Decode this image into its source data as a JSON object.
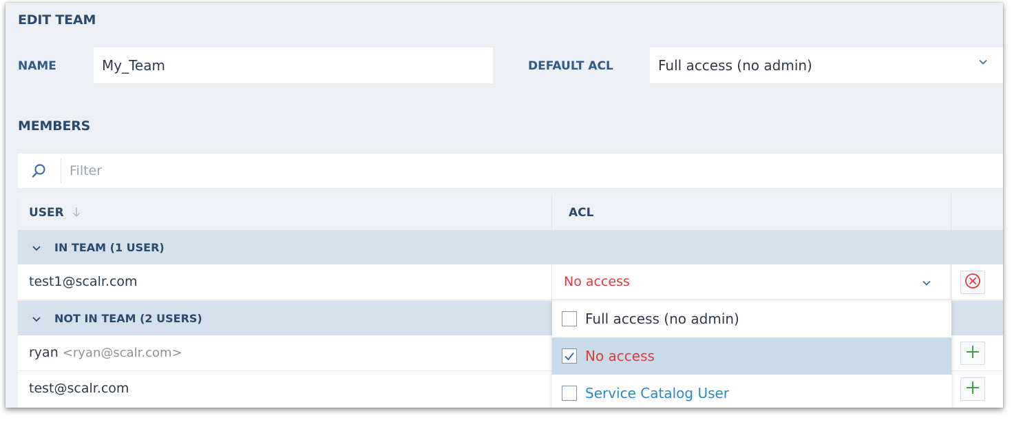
{
  "edit_team": {
    "title": "EDIT TEAM",
    "name_label": "NAME",
    "name_value": "My_Team",
    "default_acl_label": "DEFAULT ACL",
    "default_acl_value": "Full access (no admin)"
  },
  "members": {
    "title": "MEMBERS",
    "filter_placeholder": "Filter",
    "columns": {
      "user": "USER",
      "acl": "ACL"
    },
    "groups": {
      "in_team": "IN TEAM (1 USER)",
      "not_in_team": "NOT IN TEAM (2 USERS)"
    },
    "in_team_rows": [
      {
        "user": "test1@scalr.com",
        "acl": "No access"
      }
    ],
    "not_in_team_rows": [
      {
        "user_name": "ryan",
        "user_email": "<ryan@scalr.com>"
      },
      {
        "user_name": "test@scalr.com",
        "user_email": ""
      }
    ]
  },
  "acl_dropdown": {
    "options": [
      {
        "label": "Full access (no admin)",
        "checked": false,
        "color": "#2c3a4d"
      },
      {
        "label": "No access",
        "checked": true,
        "color": "#e03a3a"
      },
      {
        "label": "Service Catalog User",
        "checked": false,
        "color": "#2d86c6"
      }
    ]
  },
  "icons": {
    "search": "search-icon",
    "sort": "sort-down-arrow-icon",
    "chevron": "chevron-down-icon",
    "remove": "remove-circle-x-icon",
    "add": "plus-icon",
    "checkbox": "checkbox-icon"
  },
  "colors": {
    "panel_bg": "#ecf0f5",
    "group_bg": "#d4e1ec",
    "selected_bg": "#c9dae8",
    "remove_red": "#e03a3a",
    "add_green": "#3aa53a",
    "link_blue": "#2d86c6"
  }
}
